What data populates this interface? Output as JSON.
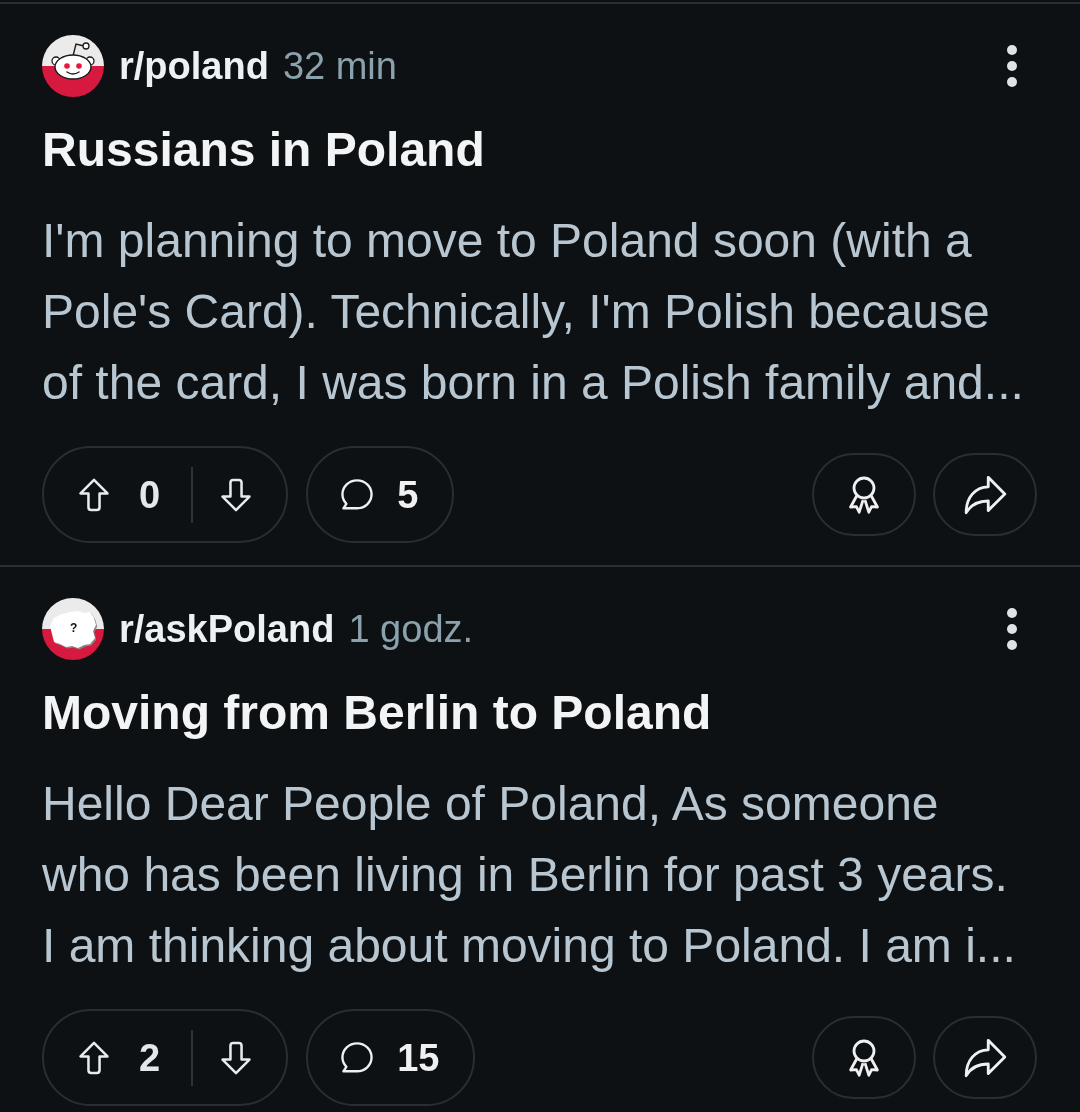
{
  "posts": [
    {
      "avatar": {
        "kind": "snoo"
      },
      "subreddit": "r/poland",
      "time": "32 min",
      "title": "Russians in Poland",
      "body": "I'm planning to move to Poland soon (with a Pole's Card). Technically, I'm Polish because of the card, I was born in a Polish family and...",
      "votes": "0",
      "comments": "5"
    },
    {
      "avatar": {
        "kind": "map",
        "mark": "?"
      },
      "subreddit": "r/askPoland",
      "time": "1 godz.",
      "title": "Moving from Berlin to Poland",
      "body": "Hello Dear People of Poland, As someone who has been living in Berlin for past 3 years. I am thinking about moving to Poland. I am i...",
      "votes": "2",
      "comments": "15"
    }
  ]
}
